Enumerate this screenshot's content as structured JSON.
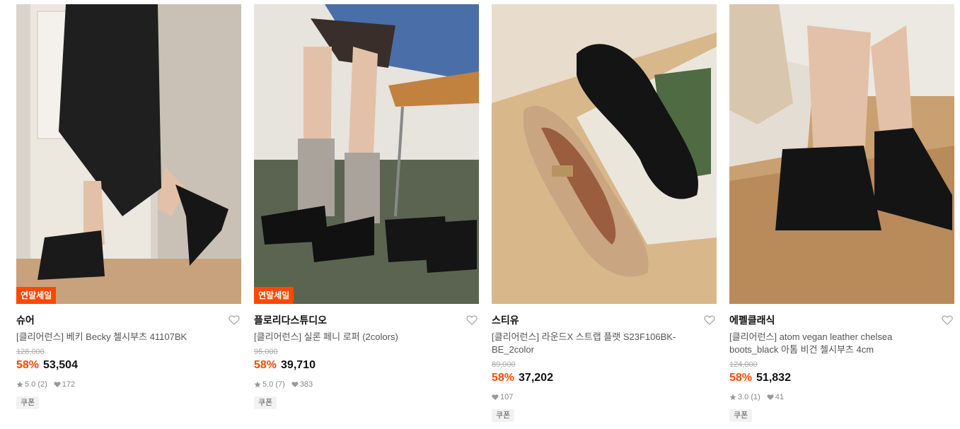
{
  "products": [
    {
      "badge": "연말세일",
      "brand": "슈어",
      "title": "[클리어런스] 베키 Becky 첼시부츠 41107BK",
      "original_price": "128,000",
      "discount": "58%",
      "price": "53,504",
      "rating": "5.0 (2)",
      "likes": "172",
      "coupon": "쿠폰"
    },
    {
      "badge": "연말세일",
      "brand": "플로리다스튜디오",
      "title": "[클리어런스] 실론 페니 로퍼 (2colors)",
      "original_price": "95,000",
      "discount": "58%",
      "price": "39,710",
      "rating": "5.0 (7)",
      "likes": "383",
      "coupon": "쿠폰"
    },
    {
      "brand": "스티유",
      "title": "[클리어런스] 라운드X 스트랩 플랫 S23F106BK-BE_2color",
      "original_price": "89,000",
      "discount": "58%",
      "price": "37,202",
      "likes": "107",
      "coupon": "쿠폰"
    },
    {
      "brand": "에펠클래식",
      "title": "[클리어런스] atom vegan leather chelsea boots_black 아톰 비건 첼시부츠 4cm",
      "original_price": "124,000",
      "discount": "58%",
      "price": "51,832",
      "rating": "3.0 (1)",
      "likes": "41",
      "coupon": "쿠폰"
    }
  ],
  "colors": {
    "accent": "#ff4800",
    "text": "#222222",
    "muted": "#888888"
  }
}
